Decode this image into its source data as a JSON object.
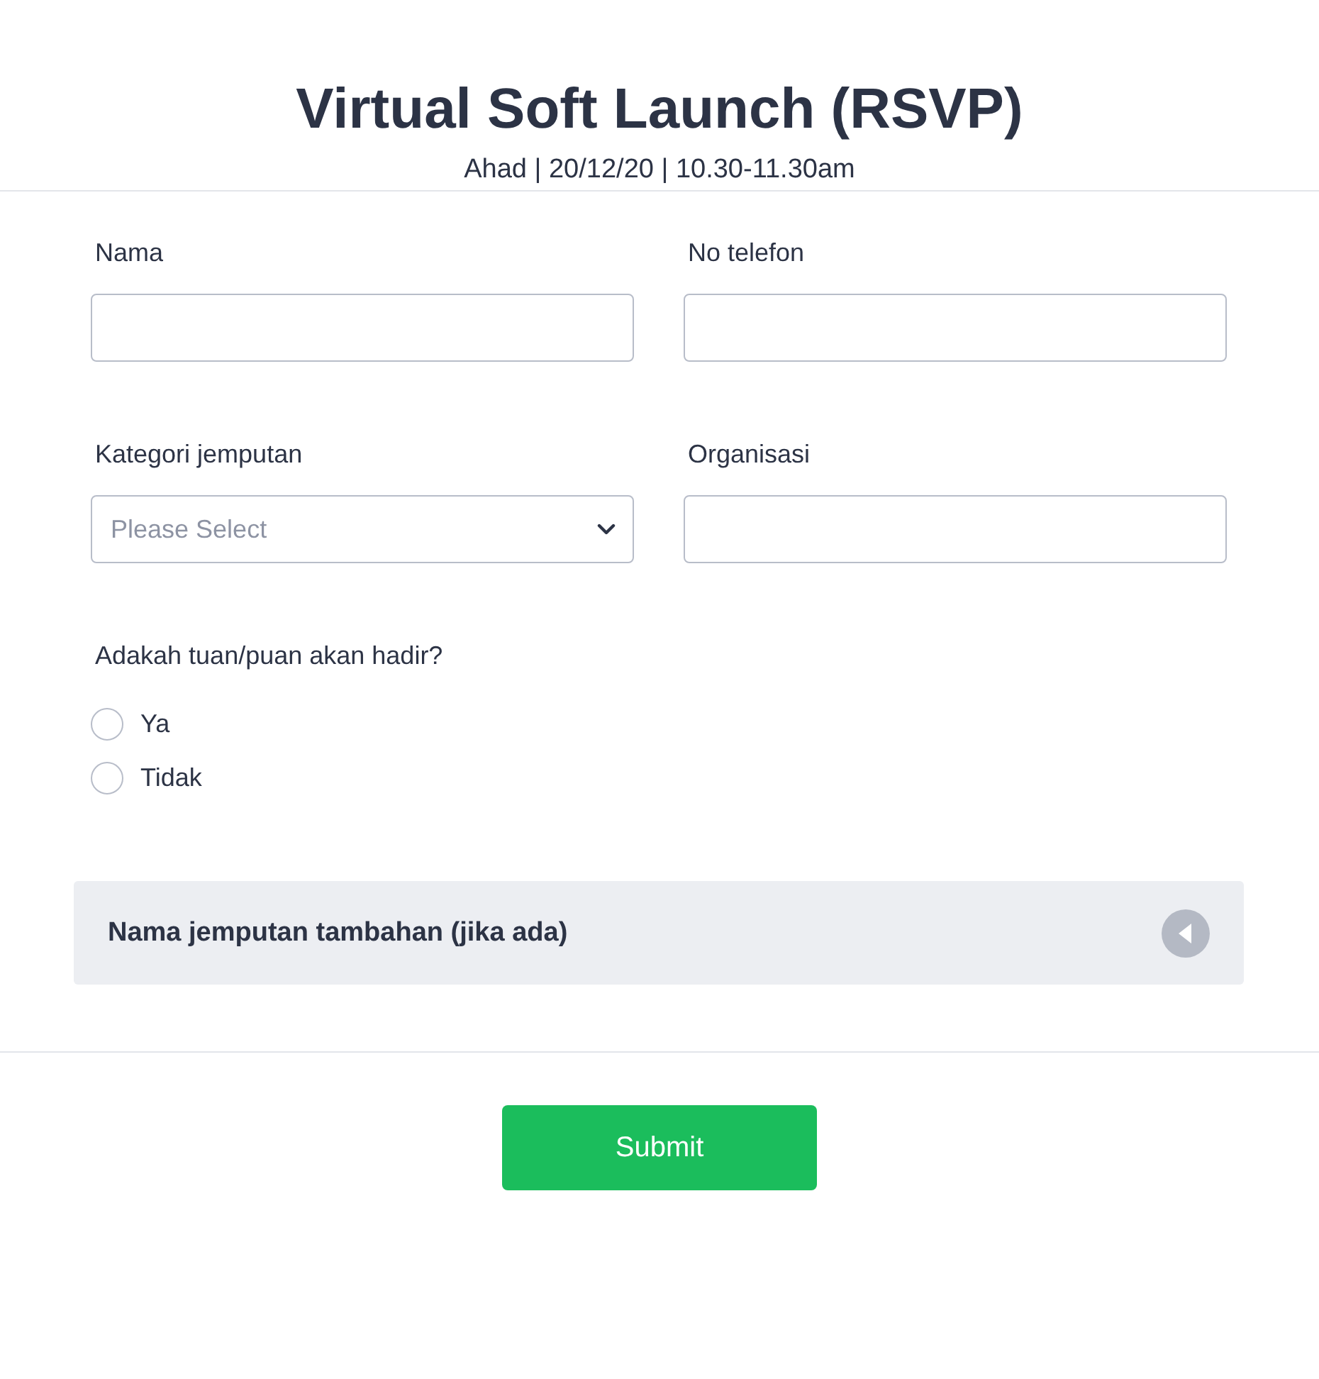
{
  "header": {
    "title": "Virtual Soft Launch (RSVP)",
    "subtitle": "Ahad | 20/12/20 | 10.30-11.30am"
  },
  "fields": [
    {
      "kind": "text",
      "label": "Nama"
    },
    {
      "kind": "text",
      "label": "No telefon"
    },
    {
      "kind": "select",
      "label": "Kategori jemputan",
      "placeholder": "Please Select"
    },
    {
      "kind": "text",
      "label": "Organisasi"
    }
  ],
  "question": {
    "label": "Adakah tuan/puan akan hadir?",
    "options": [
      {
        "label": "Ya",
        "selected": false
      },
      {
        "label": "Tidak",
        "selected": false
      }
    ]
  },
  "section": {
    "title": "Nama jemputan tambahan (jika ada)",
    "expanded": false
  },
  "submit": "Submit"
}
